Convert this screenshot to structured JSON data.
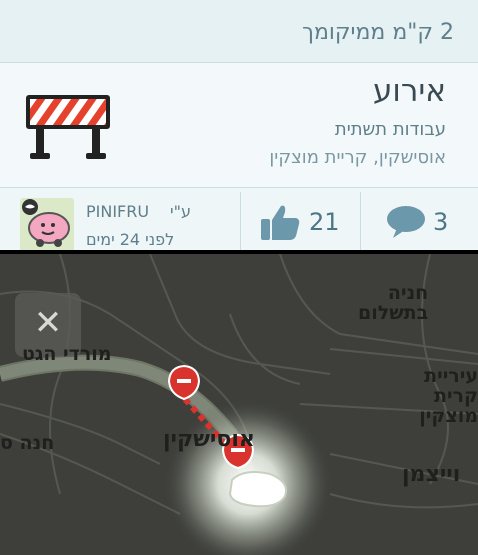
{
  "distance": "2 ק\"מ ממיקומך",
  "event": {
    "title": "אירוע",
    "subtitle": "עבודות תשתית",
    "address": "אוסישקין, קריית מוצקין",
    "icon": "road-barrier-icon"
  },
  "reporter": {
    "by_label": "ע\"י",
    "name": "PINIFRU",
    "time": "לפני 24 ימים",
    "avatar": "wazer-avatar-icon"
  },
  "likes": {
    "count": "21",
    "icon": "thumbs-up-icon"
  },
  "comments": {
    "count": "3",
    "icon": "comment-bubble-icon"
  },
  "map": {
    "close_label": "✕",
    "labels": {
      "mordi": "מורדי הגט",
      "hana_b_1": "חניה",
      "hana_b_2": "בתשלום",
      "kiryat_1": "עיריית קרית",
      "kiryat_2": "מוצקין",
      "hana": "חנה ס",
      "oshk": "אוסישקין",
      "weiz": "וייצמן"
    }
  },
  "colors": {
    "card_bg": "#eef6f8",
    "text_primary": "#3b4a52",
    "text_secondary": "#5f7f8b",
    "map_bg": "#3e3f3b",
    "alert_red": "#d8342d"
  }
}
